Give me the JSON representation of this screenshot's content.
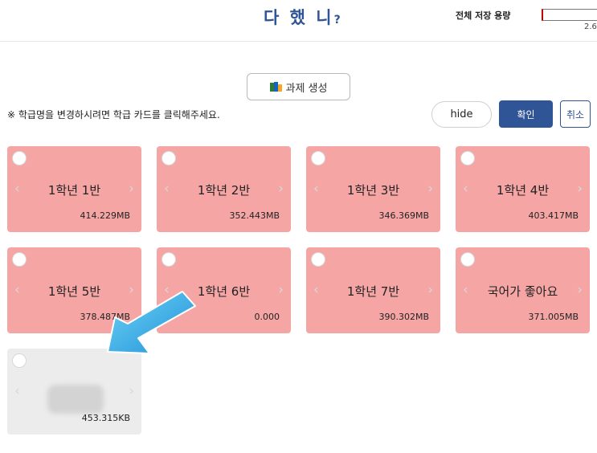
{
  "header": {
    "logo_text": "다 했 니",
    "logo_mark": "?",
    "storage_label": "전체 저장 용량",
    "storage_value": "2.6"
  },
  "toolbar": {
    "create_label": "과제 생성",
    "notice": "※ 학급명을 변경하시려면 학급 카드를 클릭해주세요.",
    "hide_label": "hide",
    "confirm_label": "확인",
    "cancel_label": "취소"
  },
  "cards": [
    {
      "name": "1학년 1반",
      "size": "414.229MB"
    },
    {
      "name": "1학년 2반",
      "size": "352.443MB"
    },
    {
      "name": "1학년 3반",
      "size": "346.369MB"
    },
    {
      "name": "1학년 4반",
      "size": "403.417MB"
    },
    {
      "name": "1학년 5반",
      "size": "378.487MB"
    },
    {
      "name": "1학년 6반",
      "size": "0.000"
    },
    {
      "name": "1학년 7반",
      "size": "390.302MB"
    },
    {
      "name": "국어가 좋아요",
      "size": "371.005MB"
    },
    {
      "name": "",
      "size": "453.315KB"
    }
  ],
  "icons": {
    "prev": "‹",
    "next": "›"
  },
  "colors": {
    "brand": "#2f5597",
    "card_pink": "#f6a5a5",
    "card_grey": "#ececec",
    "pointer_arrow": "#29a8e0"
  }
}
